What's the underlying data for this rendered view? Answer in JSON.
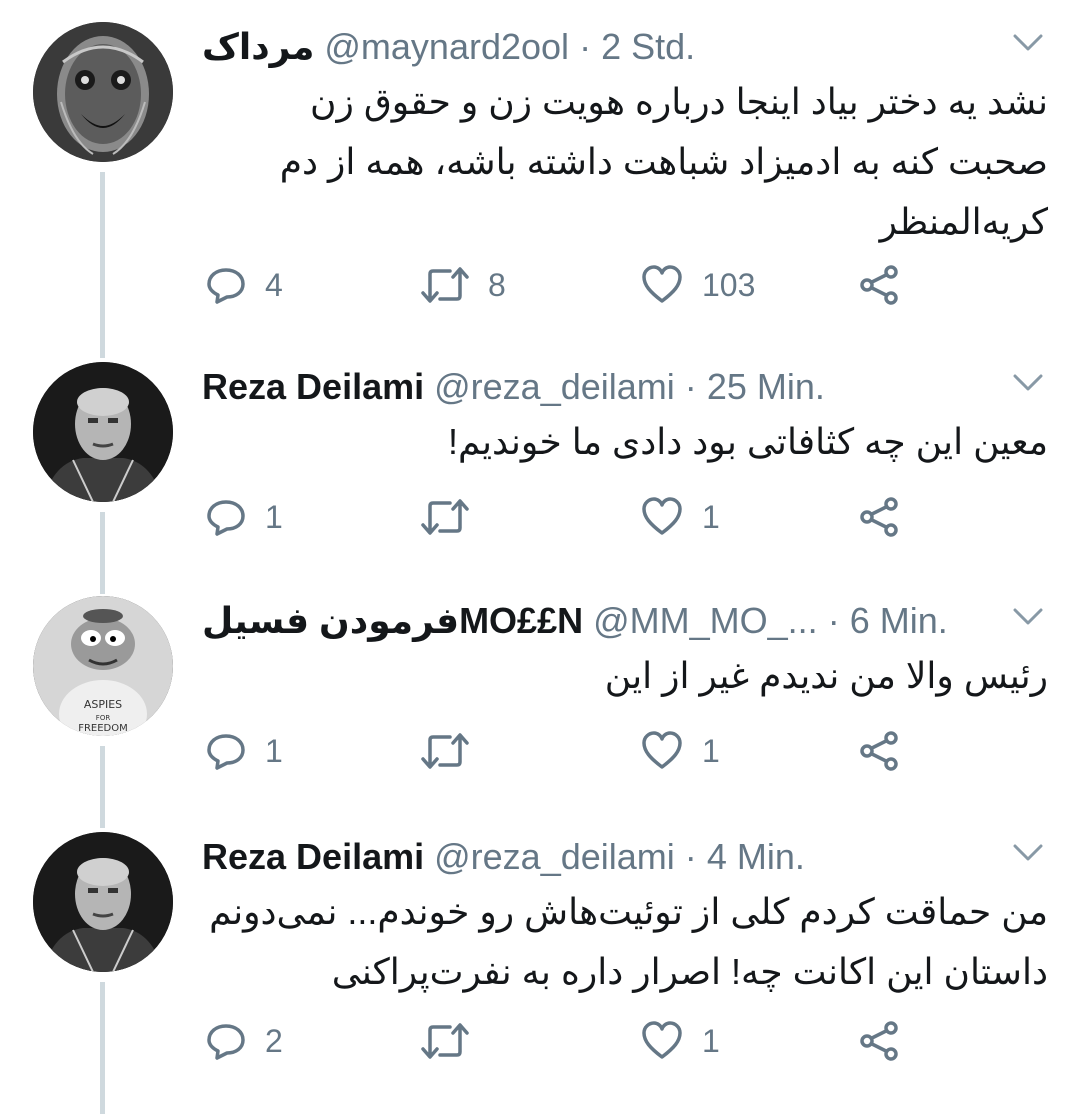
{
  "colors": {
    "text": "#14171a",
    "muted": "#657786",
    "thread_line": "#cfd9de"
  },
  "tweets": [
    {
      "name": "مرداک",
      "handle": "@maynard2ool",
      "sep": "·",
      "time": "2 Std.",
      "lines": [
        "نشد یه دختر بیاد اینجا درباره هویت زن و حقوق زن",
        "صحبت کنه به ادمیزاد شباهت داشته باشه، همه از دم",
        "کریه‌المنظر"
      ],
      "replies": "4",
      "retweets": "8",
      "likes": "103"
    },
    {
      "name": "Reza Deilami",
      "handle": "@reza_deilami",
      "sep": "·",
      "time": "25 Min.",
      "lines": [
        "معین این چه کثافاتی بود دادی ما خوندیم!"
      ],
      "replies": "1",
      "retweets": "",
      "likes": "1"
    },
    {
      "name": "فرمودن فسیلMO££N",
      "handle": "@MM_MO_...",
      "sep": "·",
      "time": "6 Min.",
      "lines": [
        "رئیس والا من ندیدم غیر از این"
      ],
      "replies": "1",
      "retweets": "",
      "likes": "1"
    },
    {
      "name": "Reza Deilami",
      "handle": "@reza_deilami",
      "sep": "·",
      "time": "4 Min.",
      "lines": [
        "من حماقت کردم کلی از توئیت‌هاش رو خوندم... نمی‌دونم",
        "داستان این اکانت چه! اصرار داره به نفرت‌پراکنی"
      ],
      "replies": "2",
      "retweets": "",
      "likes": "1"
    }
  ],
  "icons": {
    "more": "chevron-down-icon",
    "reply": "reply-icon",
    "retweet": "retweet-icon",
    "like": "heart-icon",
    "share": "share-icon"
  }
}
